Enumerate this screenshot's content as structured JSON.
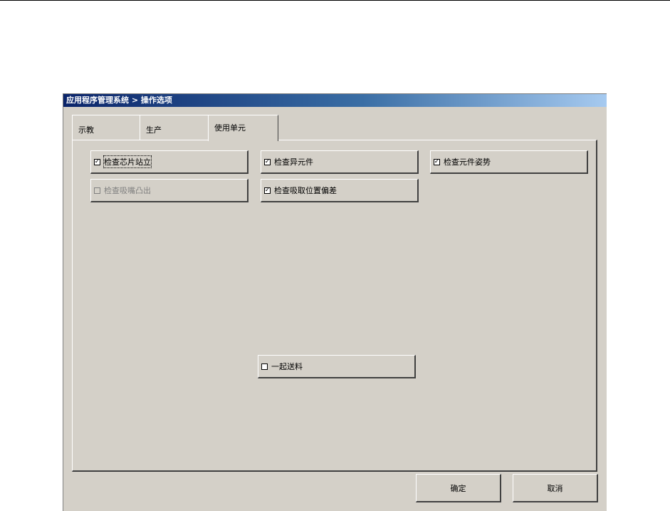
{
  "window": {
    "title": "应用程序管理系统 > 操作选项"
  },
  "tabs": [
    {
      "label": "示教",
      "active": false
    },
    {
      "label": "生产",
      "active": false
    },
    {
      "label": "使用单元",
      "active": true
    }
  ],
  "options": {
    "chip_standing": {
      "label": "检查芯片站立",
      "checked": true,
      "enabled": true,
      "mark": "✓"
    },
    "abnormal_part": {
      "label": "检查异元件",
      "checked": true,
      "enabled": true,
      "mark": "✓"
    },
    "part_posture": {
      "label": "检查元件姿势",
      "checked": true,
      "enabled": true,
      "mark": "✓"
    },
    "nozzle_protrusion": {
      "label": "检查吸嘴凸出",
      "checked": false,
      "enabled": false,
      "mark": ""
    },
    "pickup_deviation": {
      "label": "检查吸取位置偏差",
      "checked": true,
      "enabled": true,
      "mark": "✓"
    },
    "feed_together": {
      "label": "一起送料",
      "checked": false,
      "enabled": true,
      "mark": ""
    }
  },
  "buttons": {
    "ok": "确定",
    "cancel": "取消"
  }
}
